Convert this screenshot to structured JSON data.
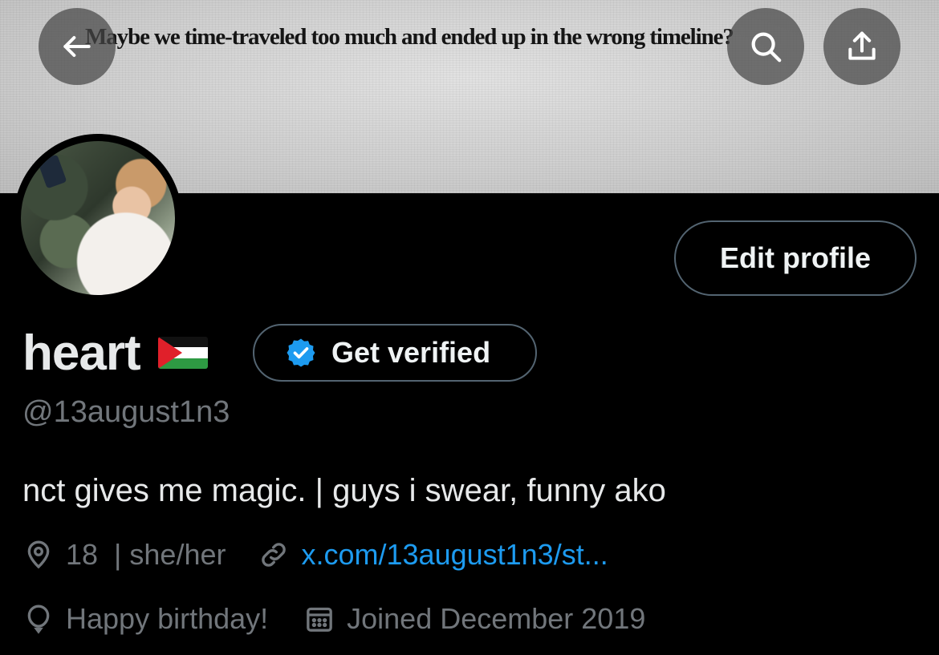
{
  "banner": {
    "text": "Maybe we time-traveled too much and ended up in the wrong timeline?"
  },
  "toolbar": {
    "back_icon": "back-arrow-icon",
    "search_icon": "search-icon",
    "share_icon": "share-icon"
  },
  "profile": {
    "edit_label": "Edit profile",
    "display_name": "heart",
    "name_emoji": "palestine-flag",
    "verify_label": "Get verified",
    "handle": "@13august1n3",
    "bio": "nct gives me magic. | guys i swear, funny ako",
    "location": "18  | she/her",
    "website": "x.com/13august1n3/st...",
    "birthday": "Happy birthday!",
    "joined": "Joined December 2019"
  },
  "colors": {
    "background": "#000000",
    "primary_text": "#e7e9ea",
    "secondary_text": "#71767b",
    "link": "#1d9bf0",
    "border": "#536471",
    "verified_badge": "#1d9bf0"
  }
}
